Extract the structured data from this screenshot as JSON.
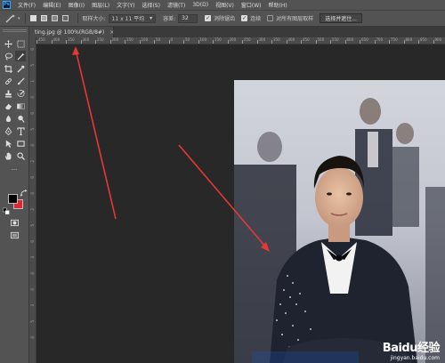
{
  "app": {
    "logo_text": "Ps"
  },
  "menu": {
    "items": [
      "文件(F)",
      "编辑(E)",
      "图像(I)",
      "图层(L)",
      "文字(Y)",
      "选择(S)",
      "滤镜(T)",
      "3D(D)",
      "视图(V)",
      "窗口(W)",
      "帮助(H)"
    ]
  },
  "options": {
    "tolerance_label": "取样大小:",
    "tolerance_select": "11 x 11 平均",
    "tolerance2_label": "容差:",
    "tolerance_value": "32",
    "antialias_label": "消除锯齿",
    "antialias_checked": true,
    "contiguous_label": "连续",
    "contiguous_checked": true,
    "sample_all_label": "对所有图层取样",
    "sample_all_checked": false,
    "select_subject_button": "选择并遮住..."
  },
  "document": {
    "tab_title": "ting.jpg @ 100%(RGB/8#)",
    "tab_close": "×"
  },
  "ruler": {
    "h_labels": [
      "450",
      "400",
      "350",
      "300",
      "250",
      "200",
      "150",
      "100",
      "50",
      "0",
      "50",
      "100",
      "150",
      "200",
      "250",
      "300",
      "350",
      "400",
      "450",
      "500",
      "550",
      "600",
      "650",
      "700",
      "750",
      "800",
      "850",
      "900",
      "950"
    ],
    "v_labels": [
      "0",
      "5",
      "1",
      "0",
      "0",
      "5",
      "0",
      "2",
      "0",
      "0",
      "2",
      "5",
      "0",
      "3",
      "0",
      "0",
      "3",
      "5",
      "0"
    ]
  },
  "watermark": {
    "brand": "Baidu经验",
    "url": "jingyan.baidu.com"
  },
  "colors": {
    "foreground": "#000000",
    "background": "#e0272d",
    "arrow": "#e53935"
  }
}
